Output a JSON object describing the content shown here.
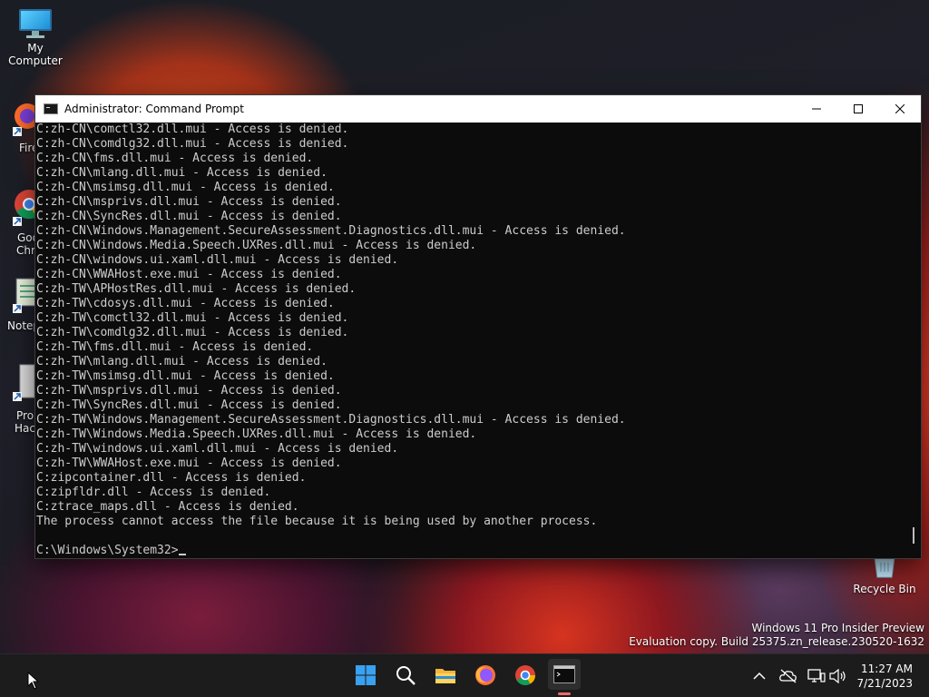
{
  "desktop": {
    "icons": [
      {
        "label": "My Computer"
      },
      {
        "label": "Recycle Bin"
      }
    ],
    "partial_labels": [
      "Fire",
      "Goo",
      "Chro",
      "Notep",
      "Pro",
      "Hack"
    ]
  },
  "window": {
    "title": "Administrator: Command Prompt",
    "lines": [
      "C:zh-CN\\comctl32.dll.mui - Access is denied.",
      "C:zh-CN\\comdlg32.dll.mui - Access is denied.",
      "C:zh-CN\\fms.dll.mui - Access is denied.",
      "C:zh-CN\\mlang.dll.mui - Access is denied.",
      "C:zh-CN\\msimsg.dll.mui - Access is denied.",
      "C:zh-CN\\msprivs.dll.mui - Access is denied.",
      "C:zh-CN\\SyncRes.dll.mui - Access is denied.",
      "C:zh-CN\\Windows.Management.SecureAssessment.Diagnostics.dll.mui - Access is denied.",
      "C:zh-CN\\Windows.Media.Speech.UXRes.dll.mui - Access is denied.",
      "C:zh-CN\\windows.ui.xaml.dll.mui - Access is denied.",
      "C:zh-CN\\WWAHost.exe.mui - Access is denied.",
      "C:zh-TW\\APHostRes.dll.mui - Access is denied.",
      "C:zh-TW\\cdosys.dll.mui - Access is denied.",
      "C:zh-TW\\comctl32.dll.mui - Access is denied.",
      "C:zh-TW\\comdlg32.dll.mui - Access is denied.",
      "C:zh-TW\\fms.dll.mui - Access is denied.",
      "C:zh-TW\\mlang.dll.mui - Access is denied.",
      "C:zh-TW\\msimsg.dll.mui - Access is denied.",
      "C:zh-TW\\msprivs.dll.mui - Access is denied.",
      "C:zh-TW\\SyncRes.dll.mui - Access is denied.",
      "C:zh-TW\\Windows.Management.SecureAssessment.Diagnostics.dll.mui - Access is denied.",
      "C:zh-TW\\Windows.Media.Speech.UXRes.dll.mui - Access is denied.",
      "C:zh-TW\\windows.ui.xaml.dll.mui - Access is denied.",
      "C:zh-TW\\WWAHost.exe.mui - Access is denied.",
      "C:zipcontainer.dll - Access is denied.",
      "C:zipfldr.dll - Access is denied.",
      "C:ztrace_maps.dll - Access is denied.",
      "The process cannot access the file because it is being used by another process.",
      "",
      "C:\\Windows\\System32>"
    ]
  },
  "watermark": {
    "line1": "Windows 11 Pro Insider Preview",
    "line2": "Evaluation copy. Build 25375.zn_release.230520-1632"
  },
  "taskbar": {
    "apps": [
      "start-icon",
      "search-icon",
      "file-explorer-icon",
      "firefox-icon",
      "chrome-icon",
      "terminal-icon"
    ],
    "clock": {
      "time": "11:27 AM",
      "date": "7/21/2023"
    }
  },
  "colors": {
    "console_bg": "#0c0c0c",
    "console_text": "#cccccc",
    "taskbar_bg": "#1c1c1c",
    "active_indicator": "#e96b6b"
  }
}
